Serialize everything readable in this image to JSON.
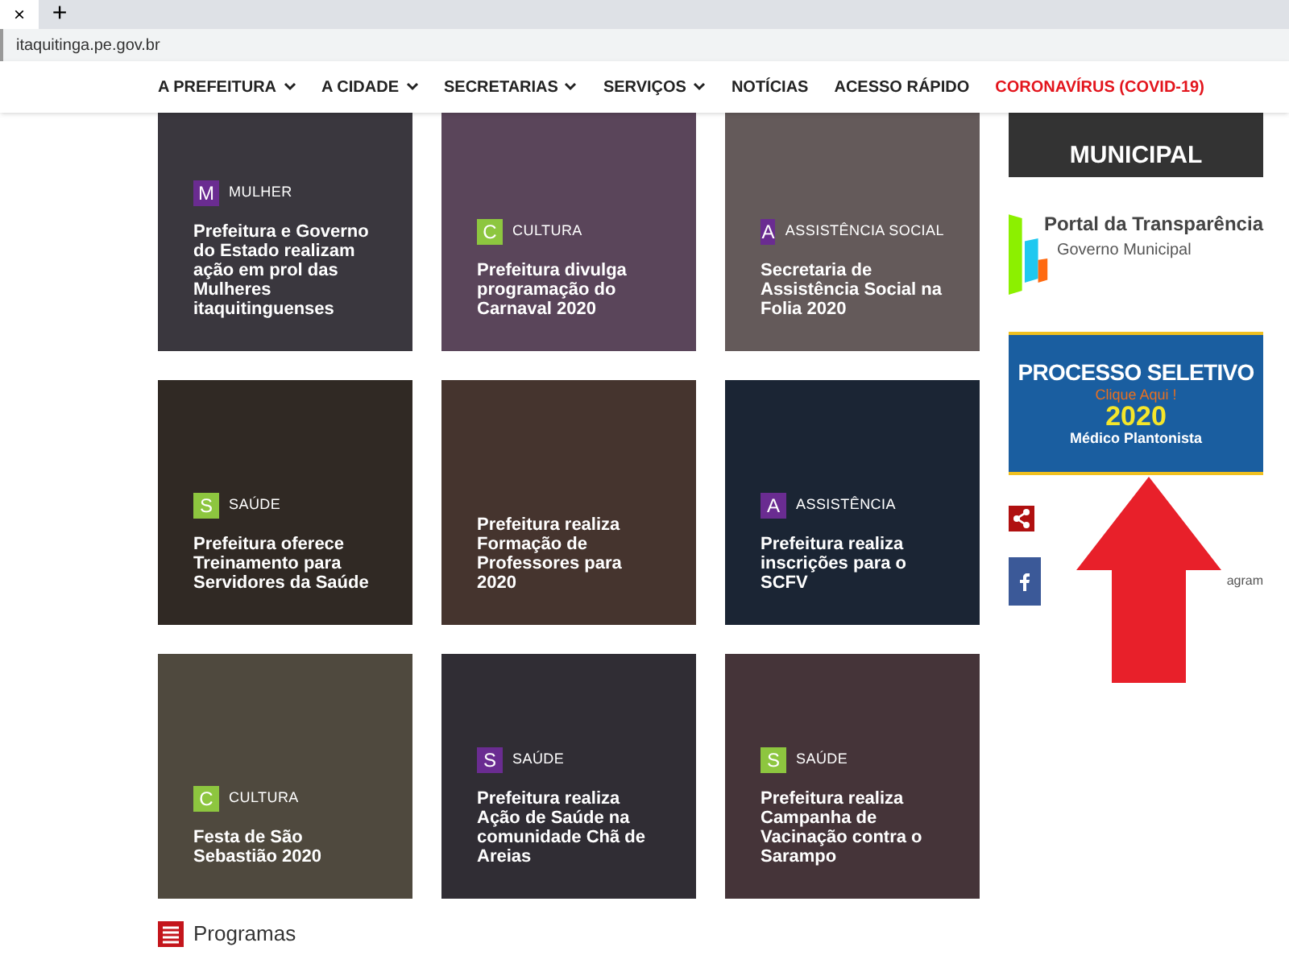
{
  "browser": {
    "close_tab": "×",
    "new_tab": "+",
    "url": "itaquitinga.pe.gov.br"
  },
  "nav": [
    {
      "label": "A PREFEITURA",
      "dropdown": true,
      "highlight": false
    },
    {
      "label": "A CIDADE",
      "dropdown": true,
      "highlight": false
    },
    {
      "label": "SECRETARIAS",
      "dropdown": true,
      "highlight": false
    },
    {
      "label": "SERVIÇOS",
      "dropdown": true,
      "highlight": false
    },
    {
      "label": "NOTÍCIAS",
      "dropdown": false,
      "highlight": false
    },
    {
      "label": "ACESSO RÁPIDO",
      "dropdown": false,
      "highlight": false
    },
    {
      "label": "CORONAVÍRUS (COVID-19)",
      "dropdown": false,
      "highlight": true
    }
  ],
  "news": [
    {
      "badge": "M",
      "category": "MULHER",
      "color": "#6a2c91",
      "title": "Prefeitura e Governo do Estado realizam ação em prol das Mulheres itaquitinguenses"
    },
    {
      "badge": "C",
      "category": "CULTURA",
      "color": "#8dc63f",
      "title": "Prefeitura divulga programação do Carnaval 2020"
    },
    {
      "badge": "A",
      "category": "ASSISTÊNCIA SOCIAL",
      "color": "#6a2c91",
      "title": "Secretaria de Assistência Social na Folia 2020"
    },
    {
      "badge": "S",
      "category": "SAÚDE",
      "color": "#8dc63f",
      "title": "Prefeitura oferece Treinamento para Servidores da Saúde"
    },
    {
      "title": "Prefeitura realiza Formação de Professores para 2020"
    },
    {
      "badge": "A",
      "category": "ASSISTÊNCIA",
      "color": "#6a2c91",
      "title": "Prefeitura realiza inscrições para o SCFV"
    },
    {
      "badge": "C",
      "category": "CULTURA",
      "color": "#8dc63f",
      "title": "Festa de São Sebastião 2020"
    },
    {
      "badge": "S",
      "category": "SAÚDE",
      "color": "#6a2c91",
      "title": "Prefeitura realiza Ação de Saúde na comunidade Chã de Areias"
    },
    {
      "badge": "S",
      "category": "SAÚDE",
      "color": "#8dc63f",
      "title": "Prefeitura realiza Campanha de Vacinação contra o Sarampo"
    }
  ],
  "section_title": "Programas",
  "sidebar": {
    "top_banner": "MUNICIPAL",
    "portal_title": "Portal da Transparência",
    "portal_subtitle": "Governo Municipal",
    "selection_banner": {
      "title": "PROCESSO SELETIVO",
      "cta": "Clique Aqui !",
      "year": "2020",
      "role": "Médico Plantonista"
    },
    "social_text": "agram"
  }
}
